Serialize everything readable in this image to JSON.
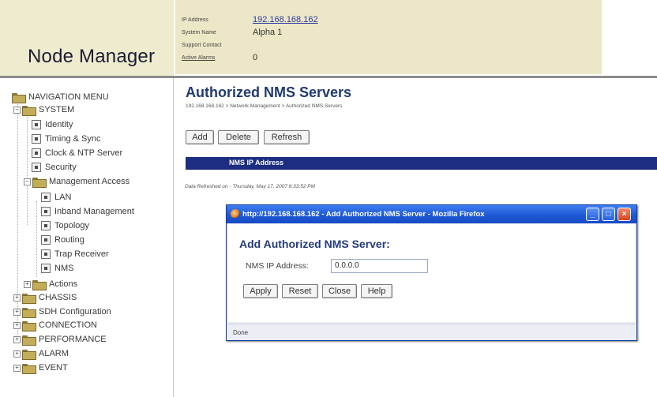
{
  "header": {
    "app_title": "Node Manager",
    "info": [
      {
        "label": "IP Address",
        "value": "192.168.168.162"
      },
      {
        "label": "System Name",
        "value": "Alpha 1"
      },
      {
        "label": "Support Contact",
        "value": ""
      },
      {
        "label": "Active Alarms",
        "value": "0"
      }
    ]
  },
  "nav": {
    "items": [
      {
        "label": "NAVIGATION MENU"
      },
      {
        "label": "SYSTEM",
        "expander": "−"
      },
      {
        "label": "Identity"
      },
      {
        "label": "Timing & Sync"
      },
      {
        "label": "Clock & NTP Server"
      },
      {
        "label": "Security"
      },
      {
        "label": "Management Access",
        "expander": "−"
      },
      {
        "label": "LAN"
      },
      {
        "label": "Inband Management"
      },
      {
        "label": "Topology"
      },
      {
        "label": "Routing"
      },
      {
        "label": "Trap Receiver"
      },
      {
        "label": "NMS"
      },
      {
        "label": "Actions",
        "expander": "+"
      },
      {
        "label": "CHASSIS",
        "expander": "+"
      },
      {
        "label": "SDH Configuration",
        "expander": "+"
      },
      {
        "label": "CONNECTION",
        "expander": "+"
      },
      {
        "label": "PERFORMANCE",
        "expander": "+"
      },
      {
        "label": "ALARM",
        "expander": "+"
      },
      {
        "label": "EVENT",
        "expander": "+"
      }
    ]
  },
  "main": {
    "title": "Authorized NMS Servers",
    "breadcrumb": "192.168.168.162 > Network Management > Authorized NMS Servers",
    "buttons": {
      "add": "Add",
      "delete": "Delete",
      "refresh": "Refresh"
    },
    "table_header": "NMS IP Address",
    "refresh_text": "Data Refreshed on - Thursday, May 17, 2007 6:33:52 PM"
  },
  "popup": {
    "window_title": "http://192.168.168.162 - Add Authorized NMS Server - Mozilla Firefox",
    "heading": "Add Authorized NMS Server:",
    "field_label": "NMS IP Address:",
    "field_value": "0.0.0.0",
    "buttons": {
      "apply": "Apply",
      "reset": "Reset",
      "close": "Close",
      "help": "Help"
    },
    "status": "Done",
    "window_controls": {
      "minimize": "_",
      "maximize": "□",
      "close": "×"
    }
  },
  "colors": {
    "header_bg": "#ece7c6",
    "title_blue": "#1f3a6e",
    "table_header_bg": "#1c2d82",
    "titlebar_blue": "#1e58d6"
  }
}
